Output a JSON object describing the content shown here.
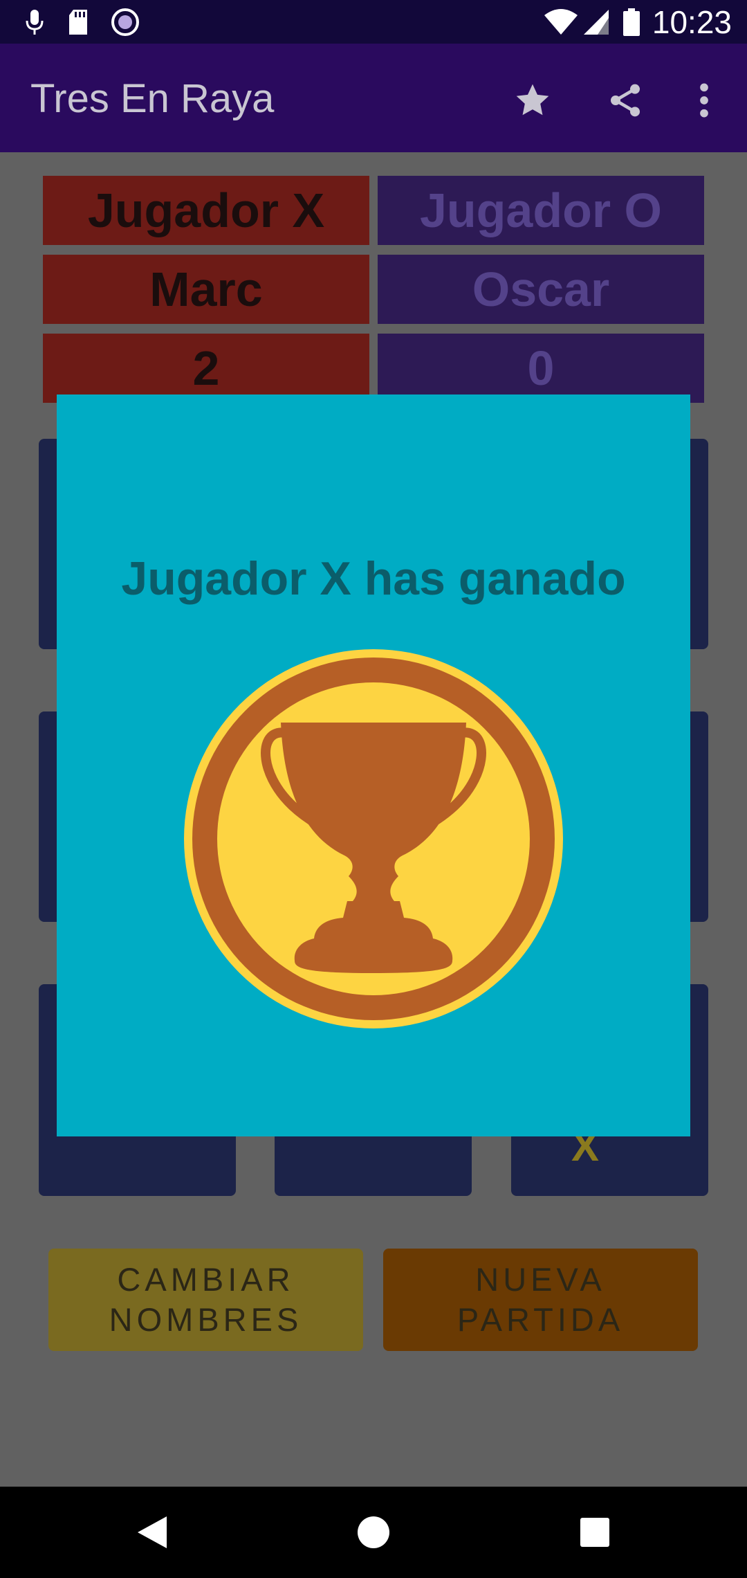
{
  "status_bar": {
    "time": "10:23",
    "icons": [
      "mic-icon",
      "sd-card-icon",
      "record-icon",
      "wifi-icon",
      "signal-icon",
      "battery-icon"
    ]
  },
  "app_bar": {
    "title": "Tres En Raya",
    "actions": [
      "star-icon",
      "share-icon",
      "overflow-menu-icon"
    ]
  },
  "scoreboard": {
    "player_x": {
      "label": "Jugador X",
      "name": "Marc",
      "score": "2",
      "color": "#6d1b16"
    },
    "player_o": {
      "label": "Jugador O",
      "name": "Oscar",
      "score": "0",
      "color": "#2d1a55"
    }
  },
  "board": {
    "cells": 9,
    "visible_mark": "X"
  },
  "buttons": {
    "change_names": "CAMBIAR\nNOMBRES",
    "new_game": "NUEVA\nPARTIDA"
  },
  "dialog": {
    "message": "Jugador X has ganado",
    "image": "trophy-icon",
    "background": "#00acc4"
  },
  "nav_bar": {
    "buttons": [
      "back-icon",
      "home-icon",
      "recents-icon"
    ]
  }
}
